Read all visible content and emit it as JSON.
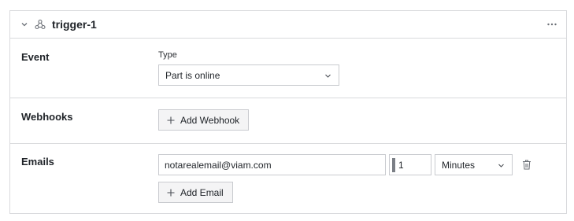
{
  "trigger": {
    "name": "trigger-1"
  },
  "event": {
    "label": "Event",
    "type_label": "Type",
    "type_value": "Part is online"
  },
  "webhooks": {
    "label": "Webhooks",
    "add_button": "Add Webhook"
  },
  "emails": {
    "label": "Emails",
    "address": "notarealemail@viam.com",
    "interval_value": "1",
    "interval_unit": "Minutes",
    "add_button": "Add Email"
  },
  "icons": {
    "collapse": "chevron-down-icon",
    "trigger": "webhook-icon",
    "more": "more-horizontal-icon",
    "caret": "chevron-down-icon",
    "plus": "plus-icon",
    "delete": "trash-icon"
  },
  "colors": {
    "border": "#d9dadd",
    "button_bg": "#f4f4f5",
    "text": "#1f2328",
    "muted_icon": "#7b7f86"
  }
}
